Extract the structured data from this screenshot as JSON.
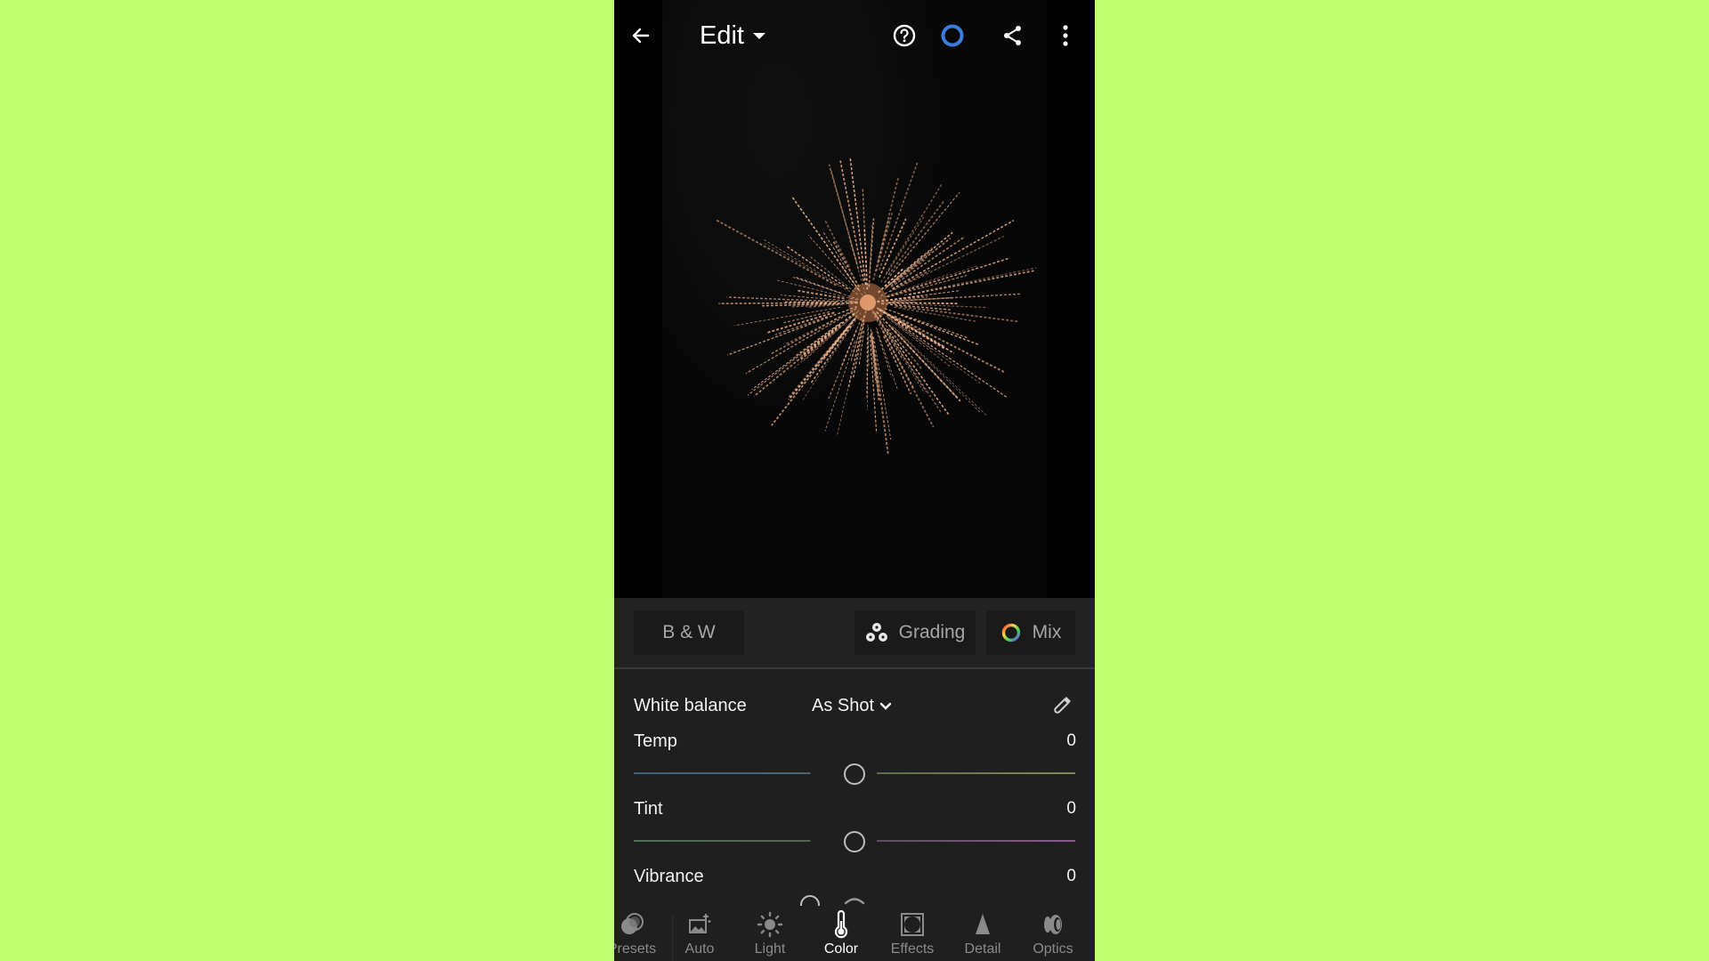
{
  "header": {
    "title": "Edit",
    "icons": [
      "back-arrow-icon",
      "help-icon",
      "sync-status-icon",
      "share-icon",
      "more-vertical-icon"
    ],
    "sync_color": "#3b82f6"
  },
  "photo": {
    "subject": "firework burst on night sky",
    "spark_color": "#f0b48c"
  },
  "color_modes": {
    "bw_label": "B & W",
    "grading_label": "Grading",
    "mix_label": "Mix"
  },
  "white_balance": {
    "label": "White balance",
    "selected": "As Shot"
  },
  "sliders": [
    {
      "name": "temp",
      "label": "Temp",
      "value": "0",
      "position": 0.5
    },
    {
      "name": "tint",
      "label": "Tint",
      "value": "0",
      "position": 0.5
    },
    {
      "name": "vibrance",
      "label": "Vibrance",
      "value": "0",
      "position": 0.5
    }
  ],
  "nav": {
    "active": "Color",
    "tabs": [
      {
        "label": "Presets",
        "icon": "presets-icon"
      },
      {
        "label": "Auto",
        "icon": "auto-icon"
      },
      {
        "label": "Light",
        "icon": "light-sun-icon"
      },
      {
        "label": "Color",
        "icon": "color-thermometer-icon"
      },
      {
        "label": "Effects",
        "icon": "effects-vignette-icon"
      },
      {
        "label": "Detail",
        "icon": "detail-triangle-icon"
      },
      {
        "label": "Optics",
        "icon": "optics-lens-icon"
      }
    ]
  }
}
